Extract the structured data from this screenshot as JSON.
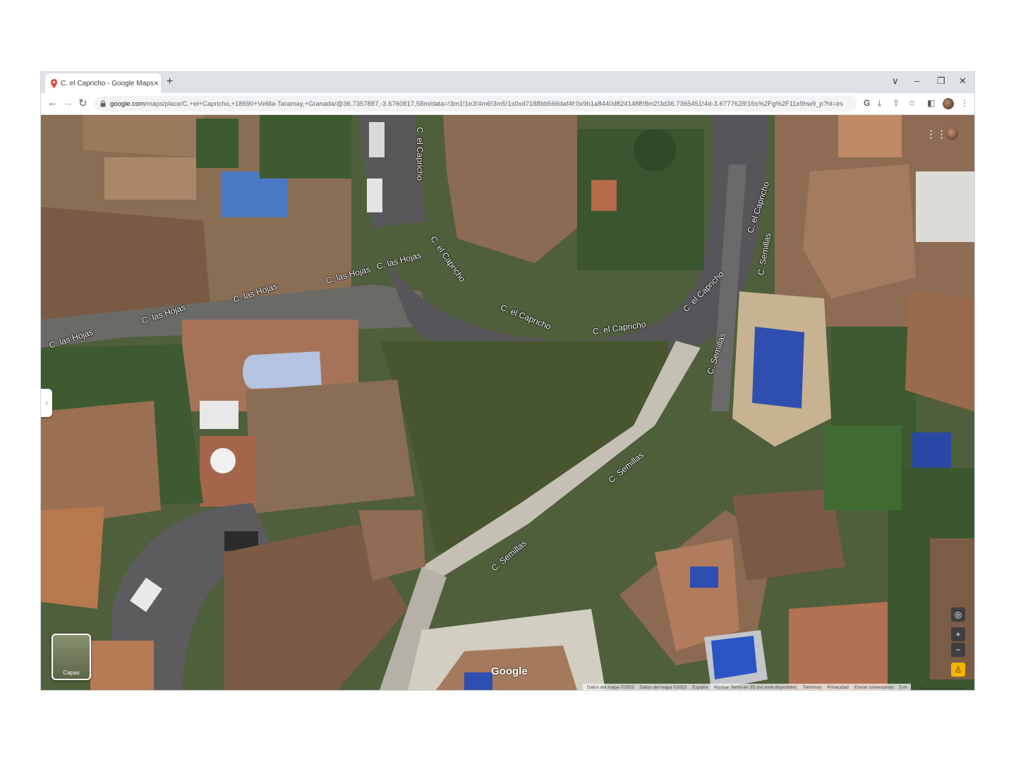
{
  "browser": {
    "tab_title": "C. el Capricho - Google Maps",
    "new_tab": "+",
    "tab_close": "×",
    "window_controls": {
      "collapse": "∨",
      "minimize": "–",
      "restore": "❐",
      "close": "✕"
    },
    "nav": {
      "back": "←",
      "forward": "→",
      "reload": "↻"
    },
    "url_host": "google.com",
    "url_path": "/maps/place/C.+el+Capricho,+18690+Velilla-Taramay,+Granada/@36.7357887,-3.6760817,58m/data=!3m1!1e3!4m6!3m5!1s0xd7188bb566daf4f:0x9b1a8440d8241488!8m2!3d36.7365451!4d-3.6777628!16s%2Fg%2F11x9hw9_p?hl=es",
    "toolbar_icons": [
      "google-icon",
      "download-icon",
      "share-icon",
      "star-icon",
      "sidepanel-icon",
      "profile-icon",
      "menu-icon"
    ]
  },
  "map": {
    "street_labels": [
      "C. el Capricho",
      "C. las Hojas",
      "C. las Hojas",
      "C. las Hojas",
      "C. las Hojas",
      "C. las Hojas",
      "C. el Capricho",
      "C. el Capricho",
      "C. el Capricho",
      "C. el Capricho",
      "C. el Capricho",
      "C. Semillas",
      "C. Semillas",
      "C. Semillas",
      "C. Semillas"
    ],
    "layers_label": "Capas",
    "google_logo": "Google",
    "attribution": [
      "Datos del mapa ©2023",
      "Datos del mapa ©2023",
      "España",
      "Mostrar Tierra en 3D (no está disponible)",
      "Términos",
      "Privacidad",
      "Enviar comentarios"
    ],
    "scale_label": "5 m",
    "zoom_in": "+",
    "zoom_out": "−",
    "colors": {
      "pool": "#2f4fb0",
      "roof": "#a3785a",
      "road": "#58585a",
      "vegetation": "#3c5a2e"
    }
  }
}
